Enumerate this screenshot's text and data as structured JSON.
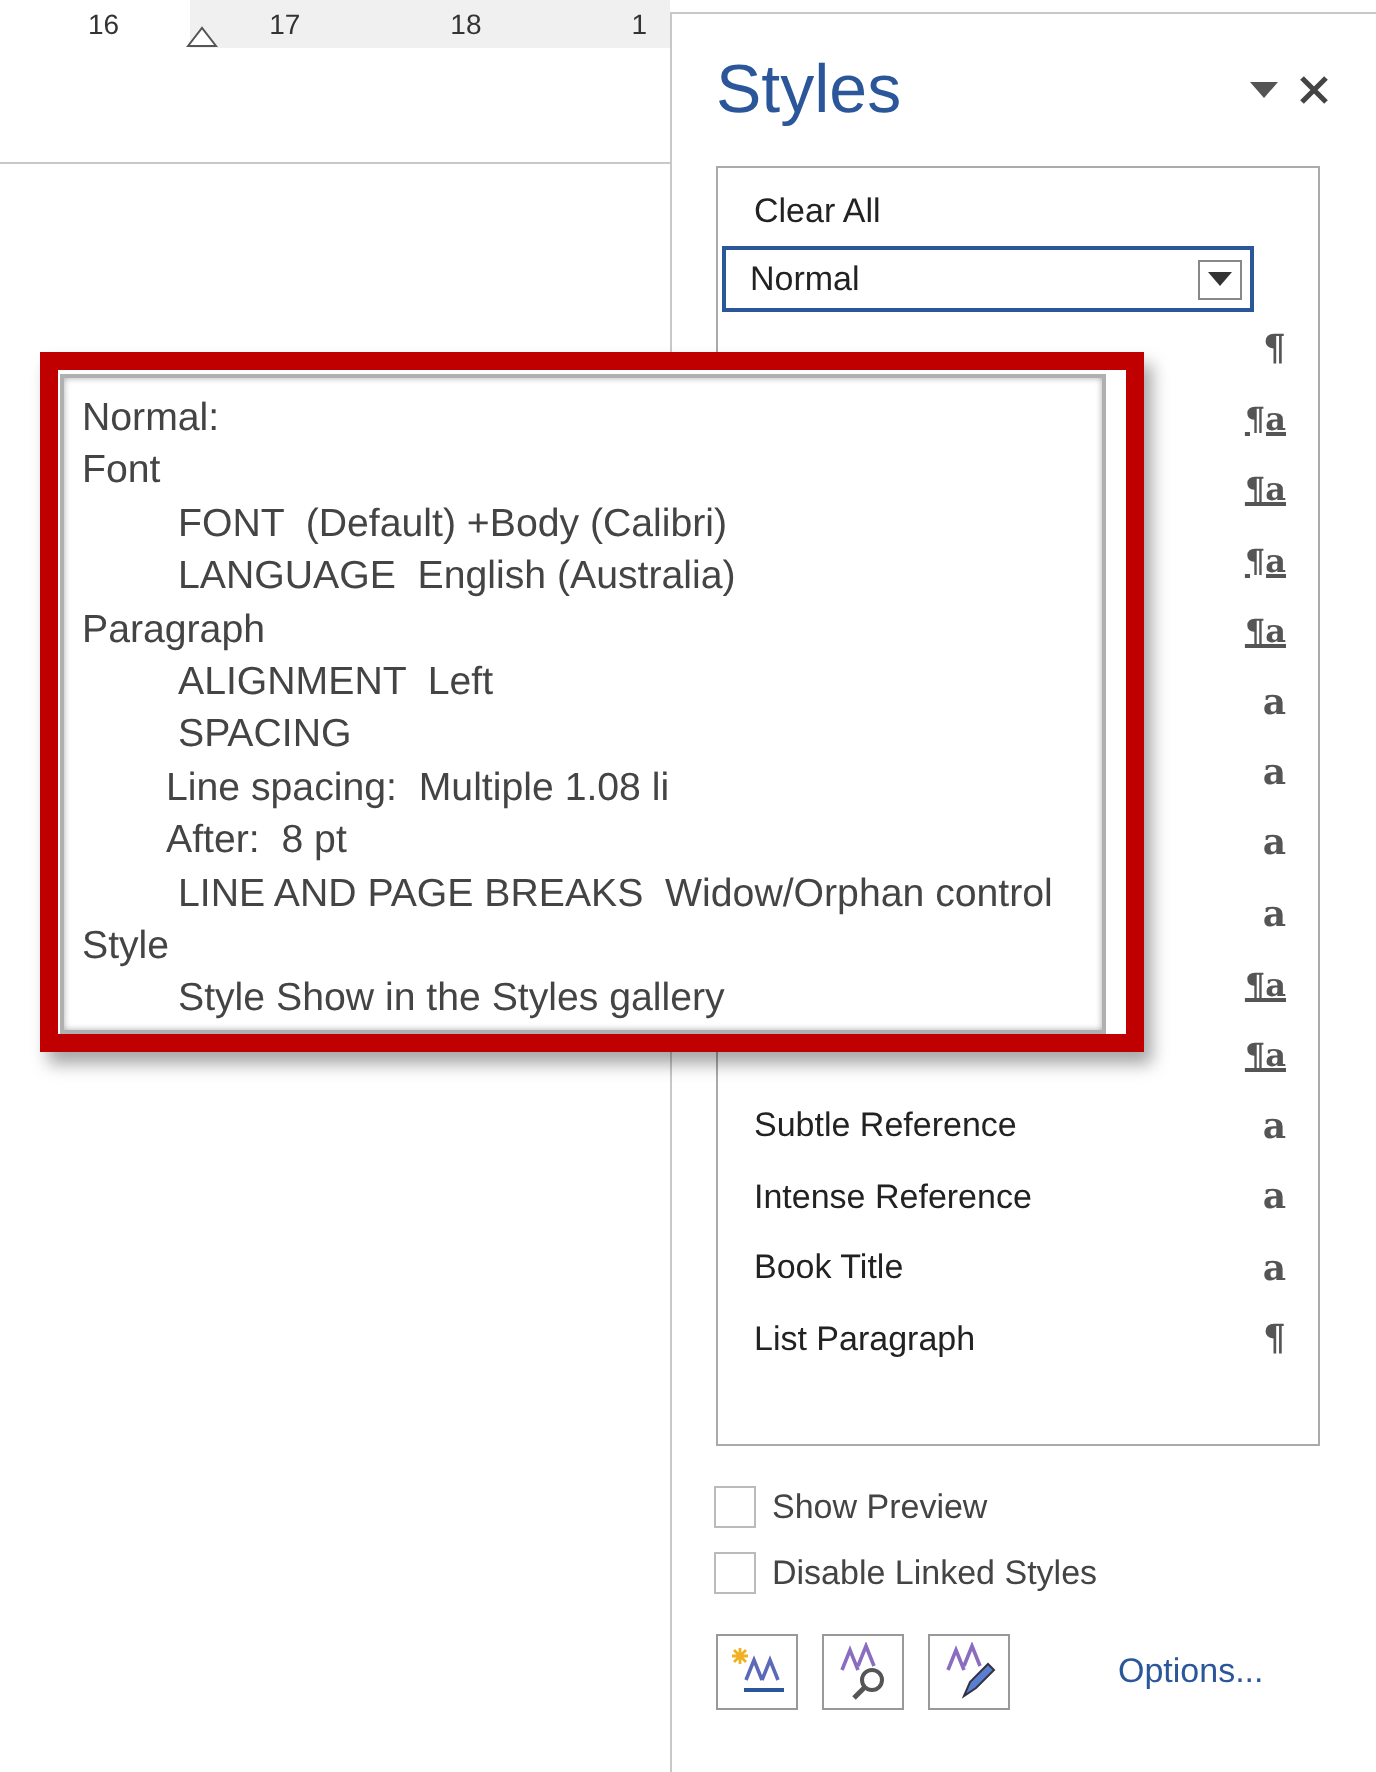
{
  "ruler": {
    "numbers": [
      "16",
      "17",
      "18",
      "1"
    ]
  },
  "styles_pane": {
    "title": "Styles",
    "clear_all": "Clear All",
    "items": [
      {
        "name": "Normal",
        "kind": "dropdown",
        "selected": true
      },
      {
        "kind": "paragraph",
        "icon": "¶",
        "selected": false
      },
      {
        "kind": "linked",
        "icon": "¶a",
        "selected": false
      },
      {
        "kind": "linked",
        "icon": "¶a",
        "selected": false
      },
      {
        "kind": "linked",
        "icon": "¶a",
        "selected": false
      },
      {
        "kind": "linked",
        "icon": "¶a",
        "selected": false
      },
      {
        "kind": "character",
        "icon": "a",
        "selected": false
      },
      {
        "kind": "character",
        "icon": "a",
        "selected": false
      },
      {
        "kind": "character",
        "icon": "a",
        "selected": false
      },
      {
        "kind": "character",
        "icon": "a",
        "selected": false
      },
      {
        "kind": "linked",
        "icon": "¶a",
        "selected": false
      },
      {
        "kind": "linked",
        "icon": "¶a",
        "selected": false
      },
      {
        "name": "Subtle Reference",
        "kind": "character",
        "icon": "a",
        "selected": false
      },
      {
        "name": "Intense Reference",
        "kind": "character",
        "icon": "a",
        "selected": false
      },
      {
        "name": "Book Title",
        "kind": "character",
        "icon": "a",
        "selected": false
      },
      {
        "name": "List Paragraph",
        "kind": "paragraph",
        "icon": "¶",
        "selected": false
      }
    ],
    "checkboxes": [
      {
        "label": "Show Preview",
        "checked": false
      },
      {
        "label": "Disable Linked Styles",
        "checked": false
      }
    ],
    "options_link": "Options..."
  },
  "tooltip": {
    "lines": [
      {
        "text": "Normal:"
      },
      {
        "text": "Font",
        "children": [
          {
            "text": "FONT  (Default) +Body (Calibri)",
            "kind": "property"
          },
          {
            "text": "LANGUAGE  English (Australia)",
            "kind": "property"
          }
        ]
      },
      {
        "text": "Paragraph",
        "children": [
          {
            "text": "ALIGNMENT  Left",
            "kind": "property"
          },
          {
            "text": "SPACING",
            "kind": "property"
          },
          {
            "text": "Line spacing:  Multiple 1.08 li",
            "kind": "value"
          },
          {
            "text": "After:  8 pt",
            "kind": "value"
          },
          {
            "text": "LINE AND PAGE BREAKS  Widow/Orphan control",
            "kind": "property"
          }
        ]
      },
      {
        "text": "Style",
        "children": [
          {
            "text": "Style Show in the Styles gallery",
            "kind": "property"
          }
        ]
      }
    ]
  }
}
